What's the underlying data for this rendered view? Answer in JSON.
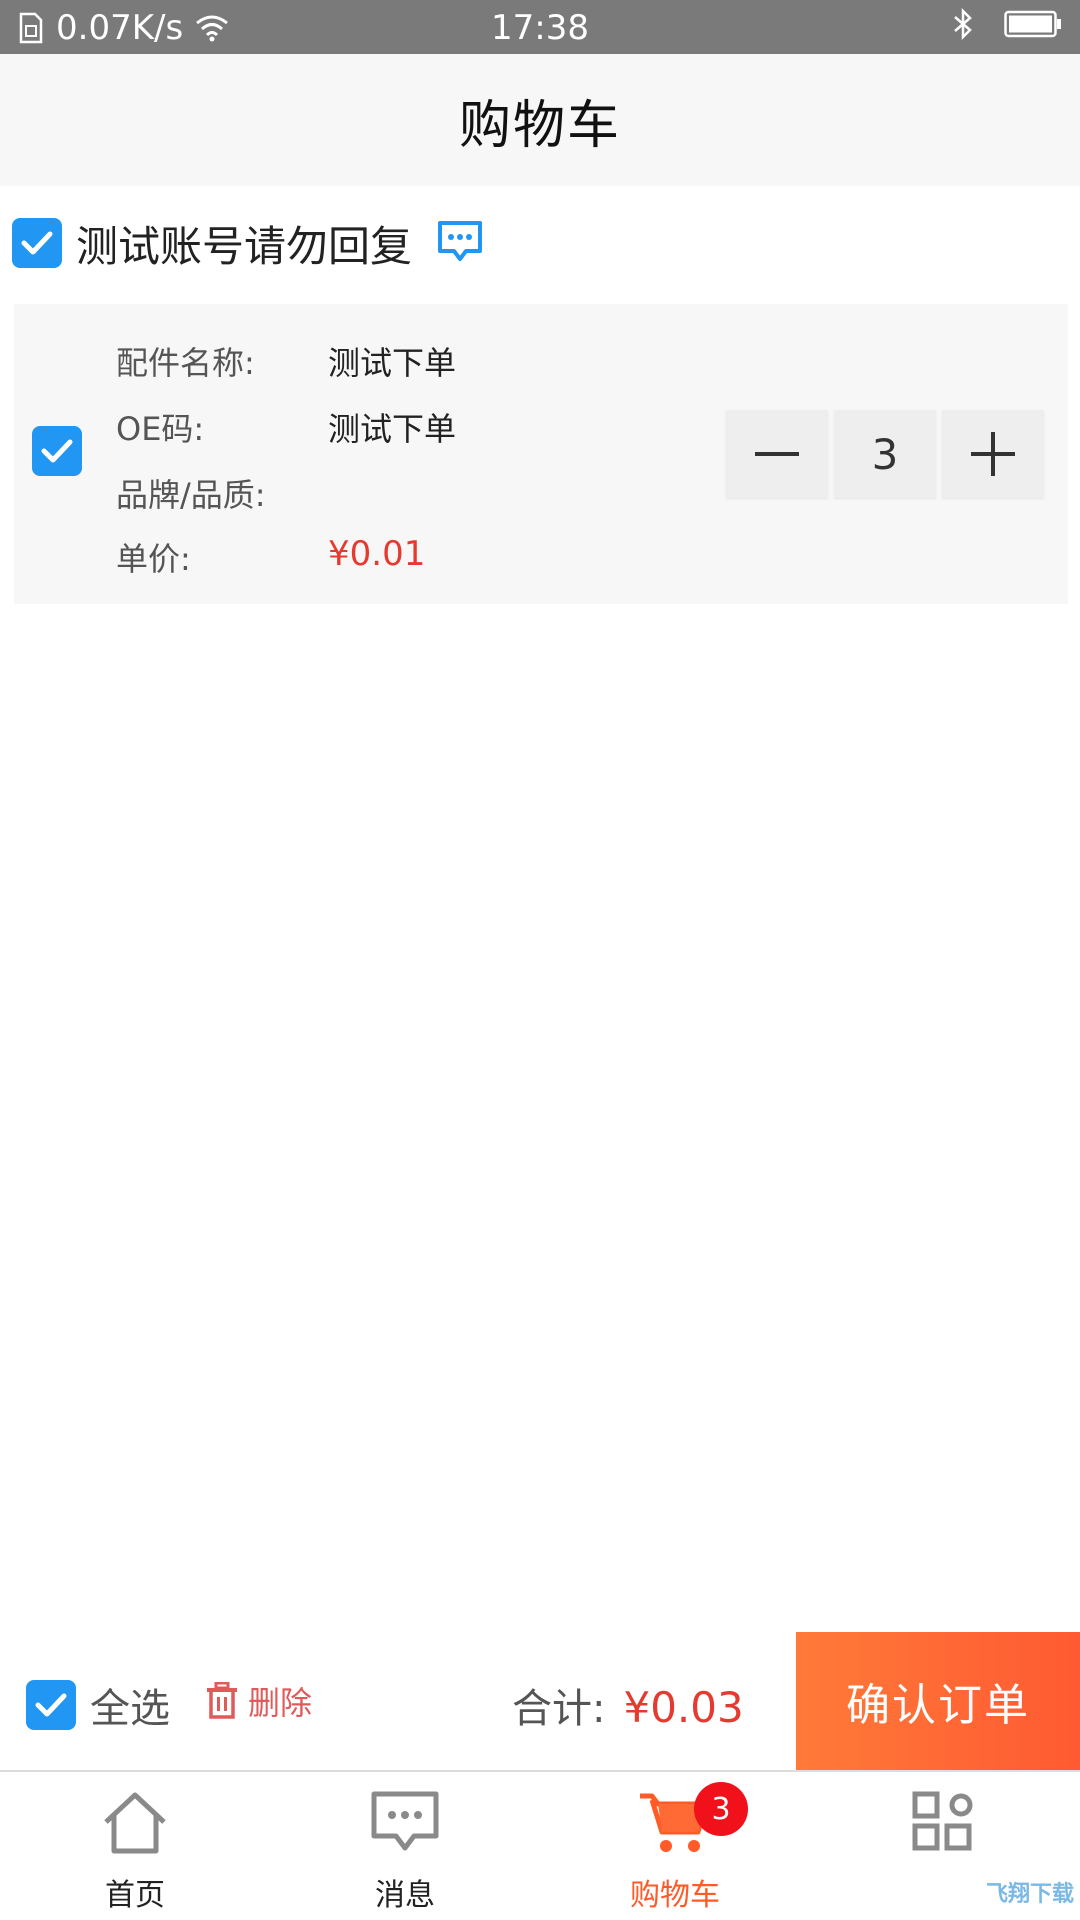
{
  "status_bar": {
    "speed": "0.07K/s",
    "time": "17:38"
  },
  "header": {
    "title": "购物车"
  },
  "store": {
    "name": "测试账号请勿回复",
    "checked": true
  },
  "item": {
    "checked": true,
    "fields": [
      {
        "label": "配件名称:",
        "value": "测试下单"
      },
      {
        "label": "OE码:",
        "value": "测试下单"
      },
      {
        "label": "品牌/品质:",
        "value": ""
      },
      {
        "label": "单价:",
        "value": "¥0.01"
      }
    ],
    "quantity": "3"
  },
  "bottom_bar": {
    "select_all_label": "全选",
    "delete_label": "删除",
    "total_label": "合计:",
    "total_value": "¥0.03",
    "confirm_label": "确认订单"
  },
  "tabs": [
    {
      "label": "首页",
      "icon": "home-icon"
    },
    {
      "label": "消息",
      "icon": "message-icon"
    },
    {
      "label": "购物车",
      "icon": "cart-icon",
      "badge": "3",
      "active": true
    },
    {
      "label": "",
      "icon": "apps-icon"
    }
  ],
  "watermark": "飞翔下载",
  "colors": {
    "accent": "#2196f3",
    "price": "#e53a2f",
    "confirm": "#ff6a35",
    "badge": "#f0111a"
  }
}
